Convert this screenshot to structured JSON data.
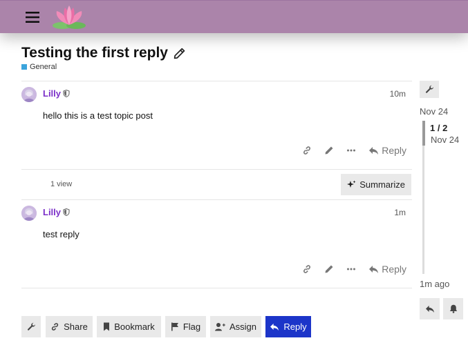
{
  "header": {
    "menu_icon": "hamburger-menu-icon",
    "logo_icon": "lotus-logo-icon",
    "accent_color": "#ab84aa"
  },
  "topic": {
    "title": "Testing the first reply",
    "edit_icon": "pencil-icon",
    "category": "General",
    "category_color": "#3ba4dc"
  },
  "posts": [
    {
      "username": "Lilly",
      "time": "10m",
      "body": "hello this is a test topic post",
      "reply_label": "Reply"
    },
    {
      "username": "Lilly",
      "time": "1m",
      "body": "test reply",
      "reply_label": "Reply"
    }
  ],
  "topic_map": {
    "views": "1 view",
    "summarize_label": "Summarize"
  },
  "footer_buttons": {
    "share": "Share",
    "bookmark": "Bookmark",
    "flag": "Flag",
    "assign": "Assign",
    "reply": "Reply",
    "primary_color": "#1c35c9"
  },
  "timeline": {
    "start_date": "Nov 24",
    "position": "1 / 2",
    "position_date": "Nov 24",
    "end_label": "1m ago"
  }
}
